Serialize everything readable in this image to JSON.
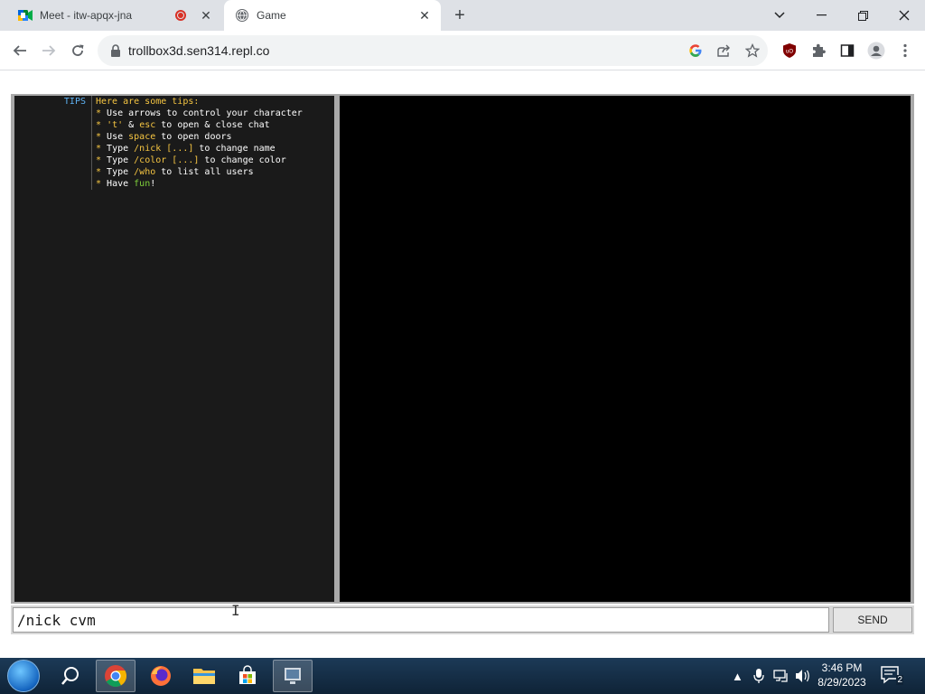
{
  "browser": {
    "tabs": [
      {
        "title": "Meet - itw-apqx-jna",
        "icon": "google-meet-icon",
        "recording": true,
        "active": false
      },
      {
        "title": "Game",
        "icon": "globe-icon",
        "active": true
      }
    ],
    "new_tab_icon": "plus-icon",
    "url": "trollbox3d.sen314.repl.co"
  },
  "chat": {
    "lines": [
      {
        "nick": "TIPS",
        "message": "Here are some tips:"
      },
      {
        "nick": "",
        "message": "* Use arrows to control your character"
      },
      {
        "nick": "",
        "message": "* 't' & esc to open & close chat"
      },
      {
        "nick": "",
        "message": "* Use space to open doors"
      },
      {
        "nick": "",
        "message": "* Type /nick [...] to change name"
      },
      {
        "nick": "",
        "message": "* Type /color [...] to change color"
      },
      {
        "nick": "",
        "message": "* Type /who to list all users"
      },
      {
        "nick": "",
        "message": "* Have fun!"
      }
    ],
    "input_value": "/nick cvm",
    "send_label": "SEND"
  },
  "taskbar": {
    "time": "3:46 PM",
    "date": "8/29/2023",
    "notification_count": "2"
  },
  "colors": {
    "tips_nick": "#5fb3f5",
    "highlight_yellow": "#f5c542",
    "highlight_green": "#7fd13b",
    "chat_bg": "#1a1a1a",
    "game_bg": "#000000"
  }
}
